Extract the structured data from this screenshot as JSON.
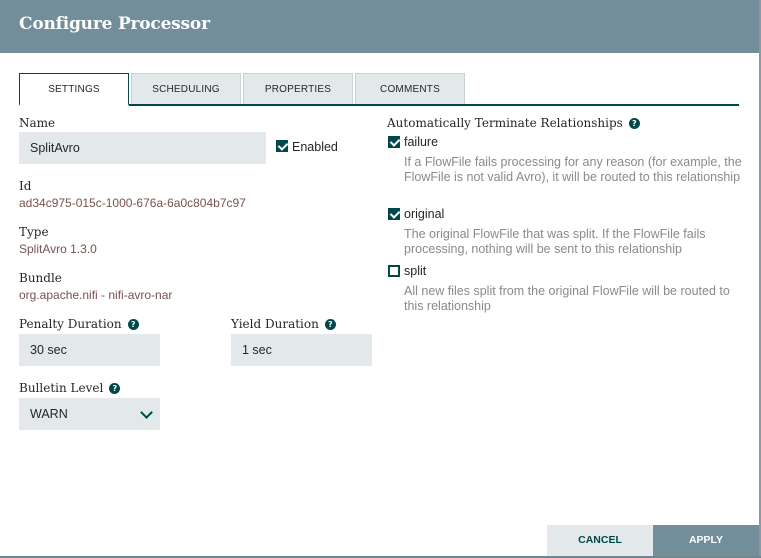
{
  "dialog": {
    "title": "Configure Processor"
  },
  "tabs": [
    {
      "label": "SETTINGS",
      "active": true
    },
    {
      "label": "SCHEDULING",
      "active": false
    },
    {
      "label": "PROPERTIES",
      "active": false
    },
    {
      "label": "COMMENTS",
      "active": false
    }
  ],
  "settings": {
    "name_label": "Name",
    "name_value": "SplitAvro",
    "enabled_label": "Enabled",
    "enabled_checked": true,
    "id_label": "Id",
    "id_value": "ad34c975-015c-1000-676a-6a0c804b7c97",
    "type_label": "Type",
    "type_value": "SplitAvro 1.3.0",
    "bundle_label": "Bundle",
    "bundle_value": "org.apache.nifi - nifi-avro-nar",
    "penalty_label": "Penalty Duration",
    "penalty_value": "30 sec",
    "yield_label": "Yield Duration",
    "yield_value": "1 sec",
    "bulletin_label": "Bulletin Level",
    "bulletin_value": "WARN"
  },
  "relationships": {
    "title": "Automatically Terminate Relationships",
    "items": [
      {
        "name": "failure",
        "checked": true,
        "description": "If a FlowFile fails processing for any reason (for example, the FlowFile is not valid Avro), it will be routed to this relationship"
      },
      {
        "name": "original",
        "checked": true,
        "description": "The original FlowFile that was split. If the FlowFile fails processing, nothing will be sent to this relationship"
      },
      {
        "name": "split",
        "checked": false,
        "description": "All new files split from the original FlowFile will be routed to this relationship"
      }
    ]
  },
  "footer": {
    "cancel_label": "CANCEL",
    "apply_label": "APPLY"
  },
  "colors": {
    "header_bg": "#728e9b",
    "accent": "#004849",
    "input_bg": "#e3e8eb",
    "value_text": "#775351"
  }
}
